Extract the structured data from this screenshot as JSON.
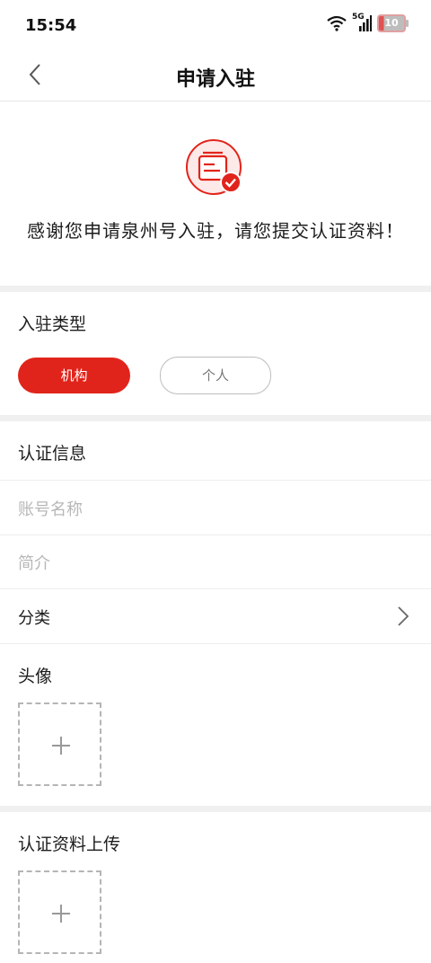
{
  "status_bar": {
    "time": "15:54",
    "network": "5G",
    "battery": "10"
  },
  "nav": {
    "title": "申请入驻"
  },
  "hero": {
    "message": "感谢您申请泉州号入驻，请您提交认证资料！"
  },
  "entry_type": {
    "title": "入驻类型",
    "options": [
      {
        "label": "机构",
        "selected": true
      },
      {
        "label": "个人",
        "selected": false
      }
    ]
  },
  "cert_info": {
    "title": "认证信息",
    "account_name_placeholder": "账号名称",
    "intro_placeholder": "简介",
    "category_label": "分类",
    "avatar_label": "头像"
  },
  "upload_section": {
    "title": "认证资料上传"
  },
  "colors": {
    "accent": "#e1241b",
    "divider": "#f0f0f0"
  }
}
